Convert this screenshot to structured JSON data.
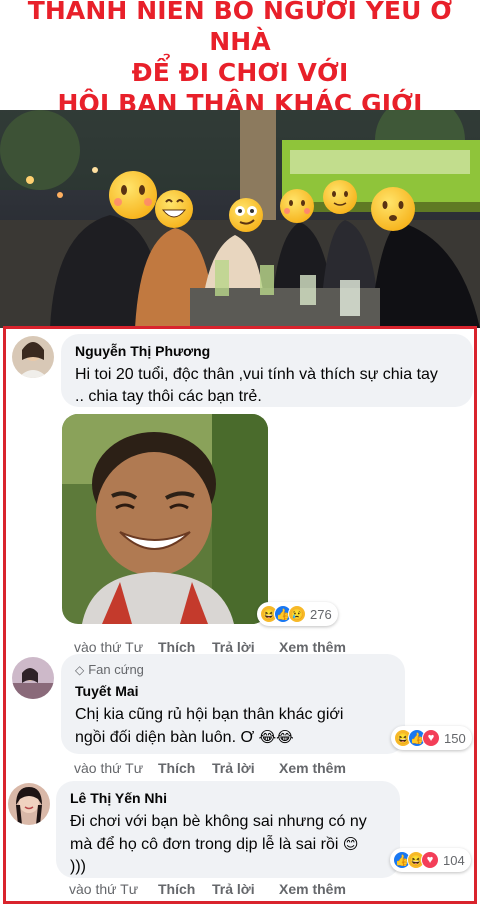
{
  "headline": {
    "line1": "THANH NIÊN BỎ NGƯỜI YÊU Ở NHÀ",
    "line2": "ĐỂ ĐI CHƠI VỚI",
    "line3": "HỘI BẠN THÂN KHÁC GIỚI",
    "color": "#e8202a"
  },
  "comments": [
    {
      "author": "Nguyễn Thị Phương",
      "text_line1": "Hi toi 20 tuổi, độc thân ,vui tính và thích sự chia tay",
      "text_line2": ".. chia tay thôi các bạn trẻ.",
      "reaction_count": "276",
      "time": "vào thứ Tư",
      "like": "Thích",
      "reply": "Trả lời",
      "more": "Xem thêm"
    },
    {
      "badge": "Fan cứng",
      "author": "Tuyết Mai",
      "text_line1": "Chị kia cũng rủ hội bạn thân khác giới",
      "text_line2": "ngồi đối diện bàn luôn. Ơ",
      "reaction_count": "150",
      "time": "vào thứ Tư",
      "like": "Thích",
      "reply": "Trả lời",
      "more": "Xem thêm"
    },
    {
      "author": "Lê Thị Yến Nhi",
      "text_line1": "Đi chơi với bạn bè không sai nhưng có ny",
      "text_line2": "mà để họ cô đơn trong dịp lễ là sai rồi",
      "text_line3": ")))",
      "reaction_count": "104",
      "time": "vào thứ Tư",
      "like": "Thích",
      "reply": "Trả lời",
      "more": "Xem thêm"
    }
  ],
  "colors": {
    "frame": "#d9232d",
    "bubble": "#f0f2f5",
    "meta_text": "#65676b",
    "like_blue": "#1877f2",
    "love_red": "#f33e58",
    "haha_yellow": "#f7b928"
  }
}
